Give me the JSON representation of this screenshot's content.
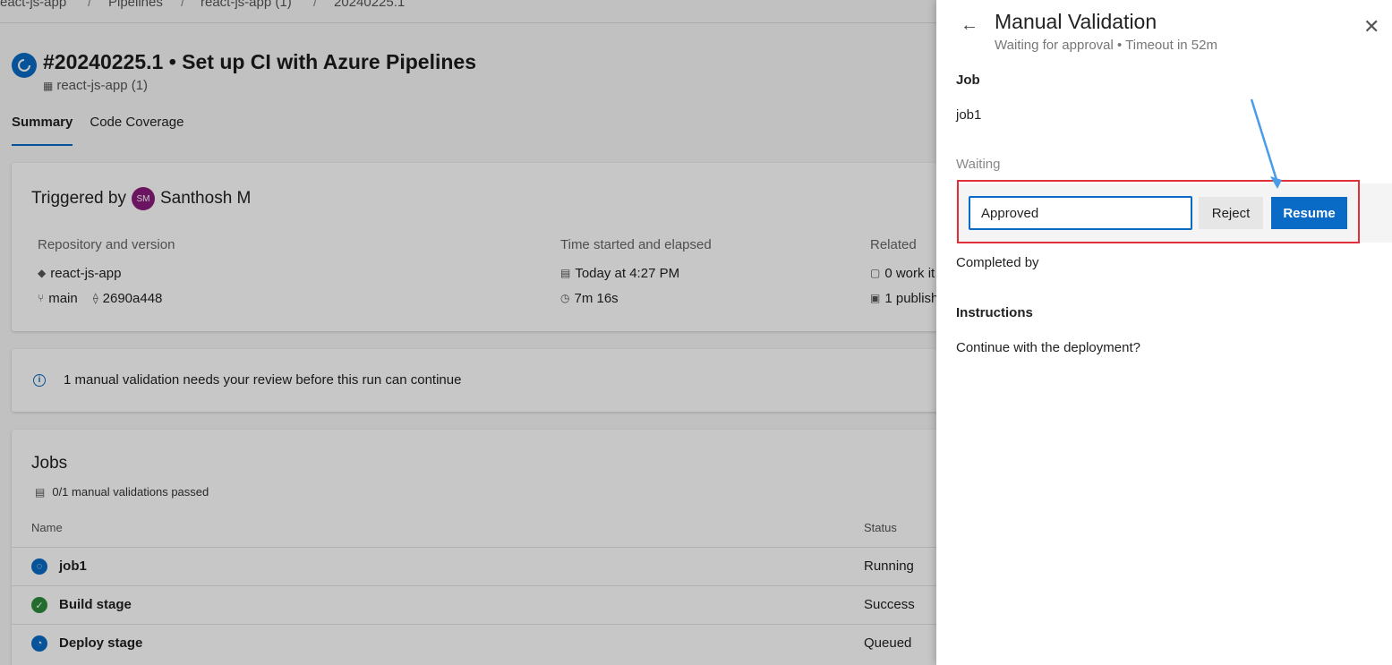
{
  "breadcrumb": {
    "items": [
      "eact-js-app",
      "Pipelines",
      "react-js-app (1)",
      "20240225.1"
    ],
    "separator": "/"
  },
  "run": {
    "title": "#20240225.1 • Set up CI with Azure Pipelines",
    "pipeline": "react-js-app (1)"
  },
  "tabs": [
    {
      "label": "Summary",
      "active": true
    },
    {
      "label": "Code Coverage",
      "active": false
    }
  ],
  "trigger": {
    "label": "Triggered by",
    "avatar_initials": "SM",
    "user": "Santhosh M"
  },
  "repo": {
    "header": "Repository and version",
    "name": "react-js-app",
    "branch": "main",
    "commit": "2690a448"
  },
  "time": {
    "header": "Time started and elapsed",
    "started": "Today at 4:27 PM",
    "elapsed": "7m 16s"
  },
  "related": {
    "header": "Related",
    "work_items": "0 work it",
    "published": "1 publish"
  },
  "notice": {
    "text": "1 manual validation needs your review before this run can continue"
  },
  "jobs": {
    "title": "Jobs",
    "summary": "0/1 manual validations passed",
    "col_name": "Name",
    "col_status": "Status",
    "rows": [
      {
        "name": "job1",
        "status": "Running",
        "color": "#0a6bc6"
      },
      {
        "name": "Build stage",
        "status": "Success",
        "color": "#2e8b3a"
      },
      {
        "name": "Deploy stage",
        "status": "Queued",
        "color": "#0a6bc6"
      }
    ]
  },
  "panel": {
    "title": "Manual Validation",
    "subtitle": "Waiting for approval • Timeout in 52m",
    "job_label": "Job",
    "job_value": "job1",
    "waiting_label": "Waiting",
    "input_value": "Approved",
    "reject_label": "Reject",
    "resume_label": "Resume",
    "completed_label": "Completed by",
    "instructions_label": "Instructions",
    "instructions_text": "Continue with the deployment?"
  },
  "colors": {
    "accent": "#0a6bc6",
    "highlight": "#e0313b",
    "annotation_arrow": "#4a9be8"
  }
}
